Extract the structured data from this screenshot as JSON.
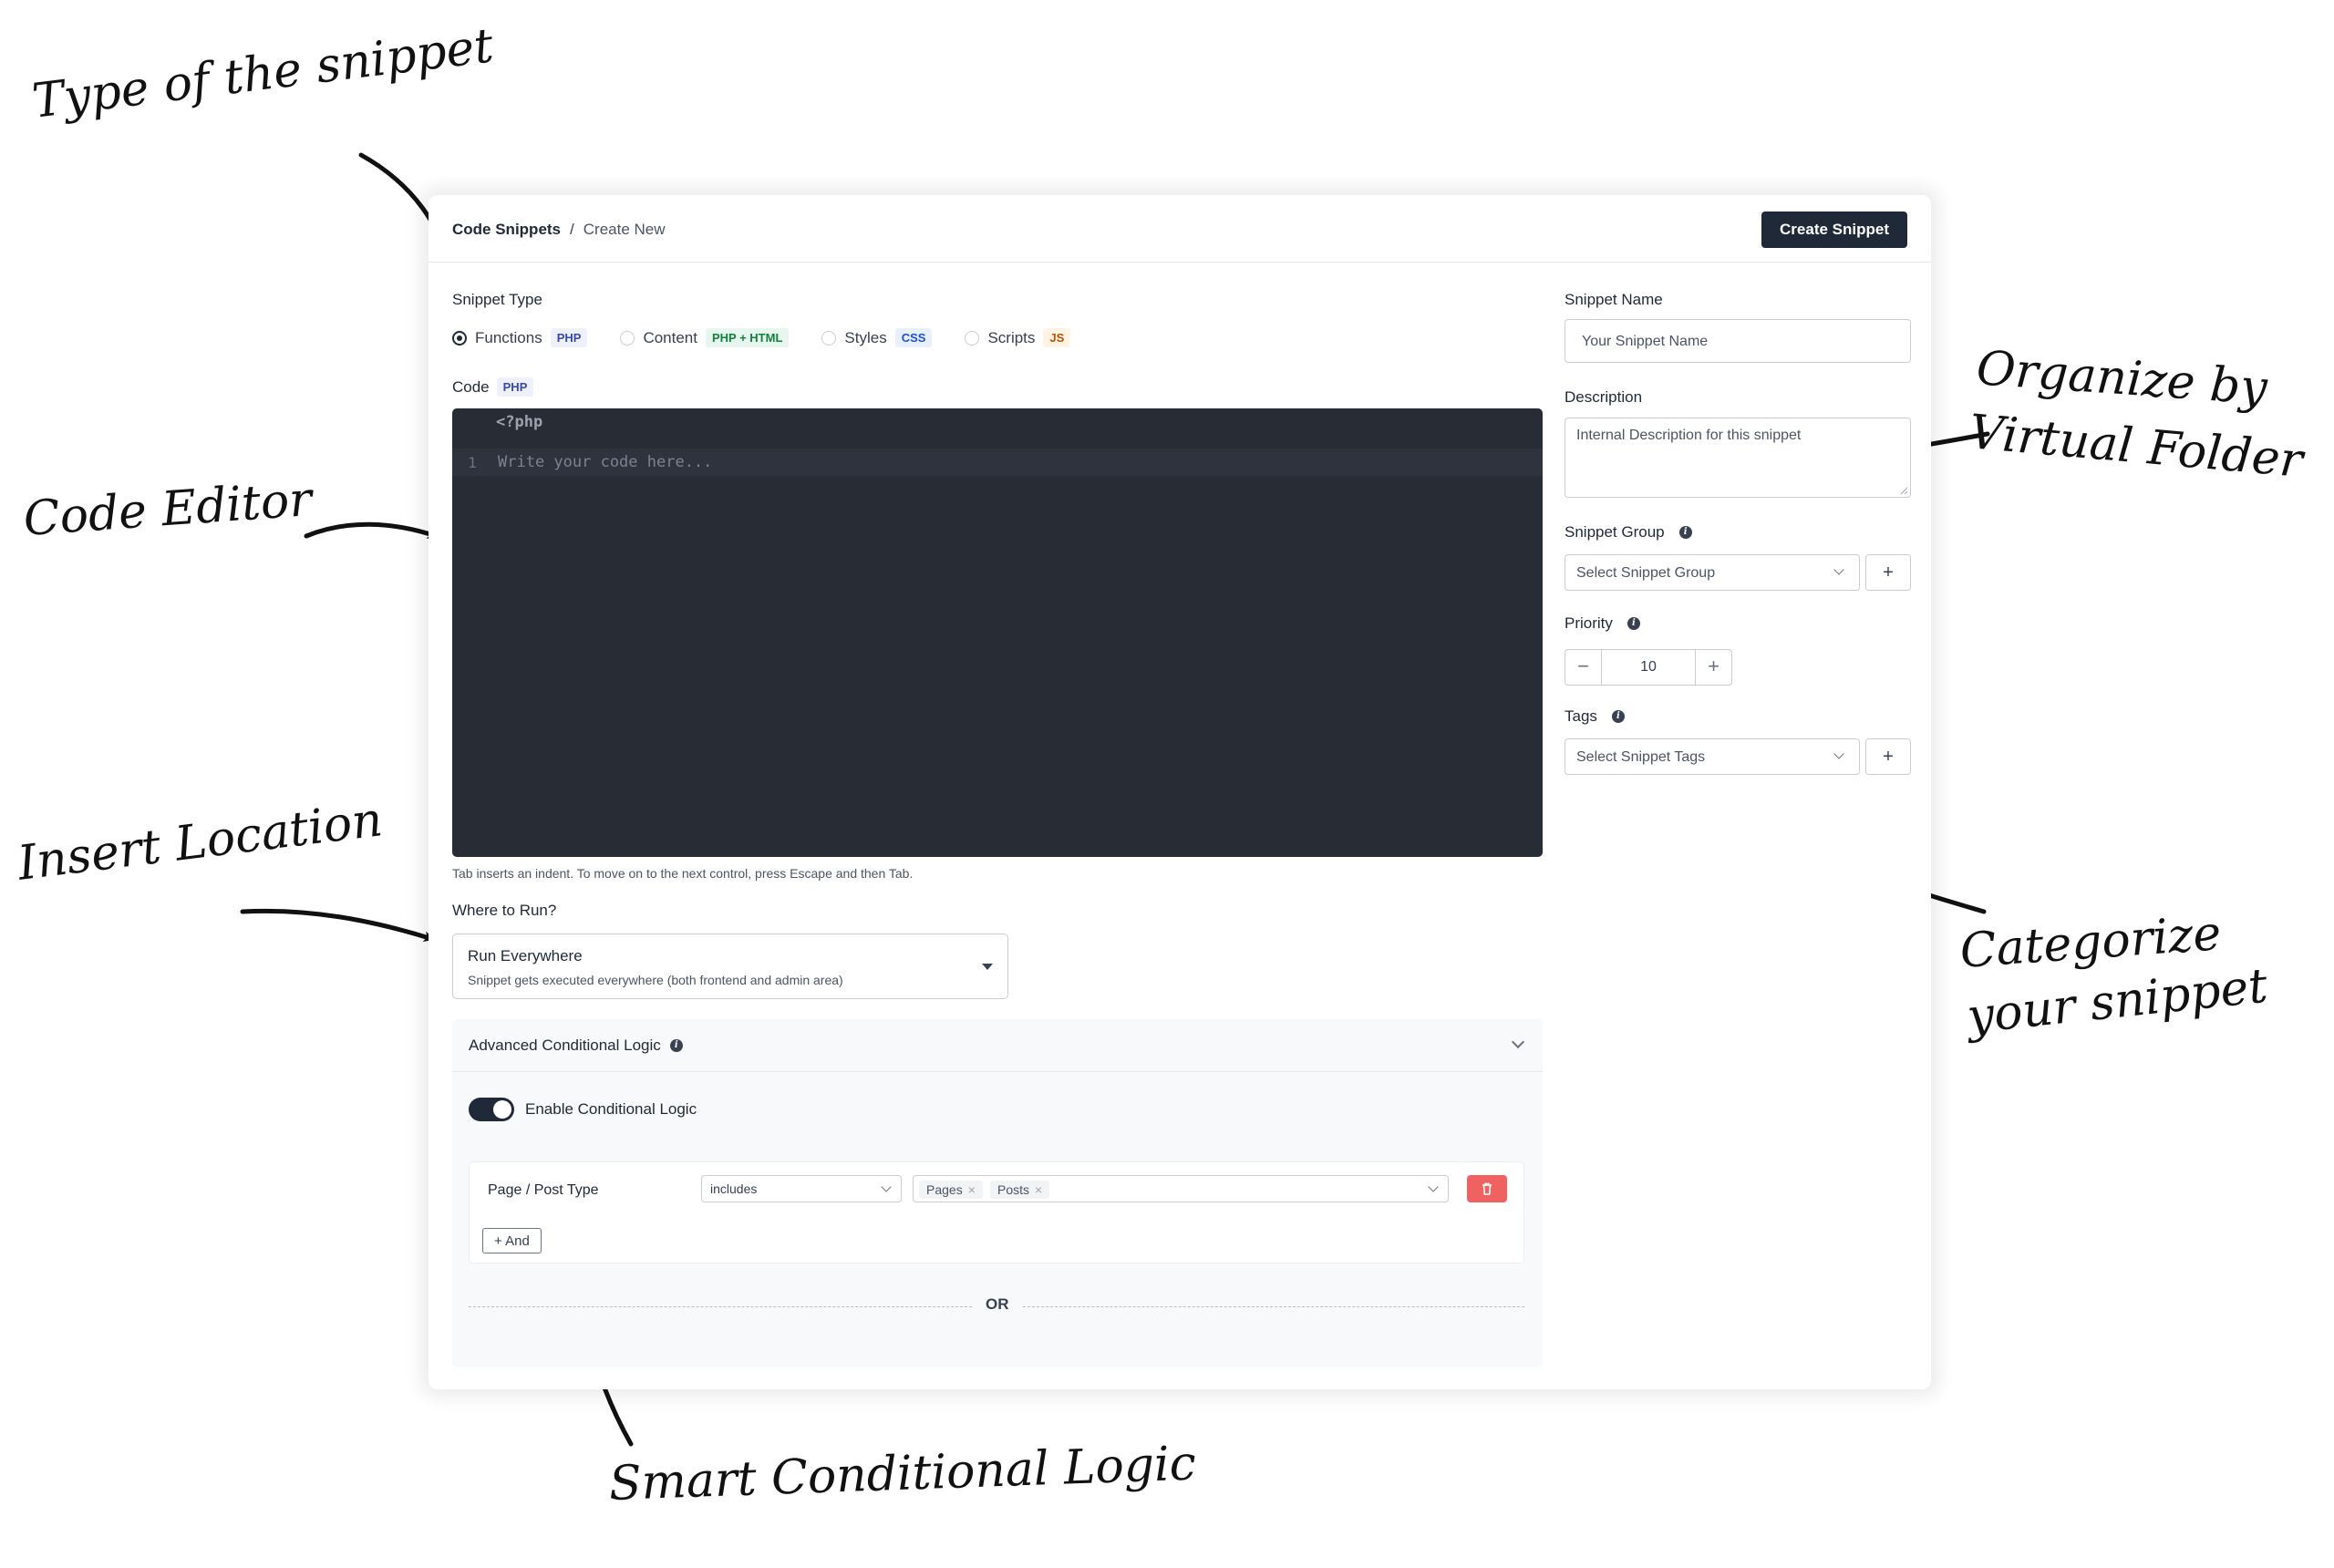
{
  "annotations": {
    "type": "Type of the snippet",
    "editor": "Code Editor",
    "location": "Insert Location",
    "folder_line1": "Organize by",
    "folder_line2": "Virtual Folder",
    "categorize_line1": "Categorize",
    "categorize_line2": "your snippet",
    "conditional": "Smart Conditional Logic"
  },
  "breadcrumb": {
    "root": "Code Snippets",
    "separator": "/",
    "current": "Create New"
  },
  "header": {
    "create_button": "Create Snippet"
  },
  "snippet_type": {
    "label": "Snippet Type",
    "options": [
      {
        "label": "Functions",
        "badge": "PHP",
        "selected": true
      },
      {
        "label": "Content",
        "badge": "PHP + HTML",
        "selected": false
      },
      {
        "label": "Styles",
        "badge": "CSS",
        "selected": false
      },
      {
        "label": "Scripts",
        "badge": "JS",
        "selected": false
      }
    ]
  },
  "code": {
    "label": "Code",
    "badge": "PHP",
    "header": "<?php",
    "line_number": "1",
    "placeholder": "Write your code here...",
    "hint": "Tab inserts an indent. To move on to the next control, press Escape and then Tab."
  },
  "where_to_run": {
    "label": "Where to Run?",
    "selected": "Run Everywhere",
    "description": "Snippet gets executed everywhere (both frontend and admin area)"
  },
  "advanced": {
    "title": "Advanced Conditional Logic",
    "toggle_label": "Enable Conditional Logic",
    "toggle_on": true,
    "condition": {
      "field": "Page / Post Type",
      "operator": "includes",
      "values": [
        "Pages",
        "Posts"
      ]
    },
    "and_button": "+ And",
    "or_label": "OR"
  },
  "right": {
    "name_label": "Snippet Name",
    "name_placeholder": "Your Snippet Name",
    "desc_label": "Description",
    "desc_placeholder": "Internal Description for this snippet",
    "group_label": "Snippet Group",
    "group_placeholder": "Select Snippet Group",
    "priority_label": "Priority",
    "priority_value": "10",
    "tags_label": "Tags",
    "tags_placeholder": "Select Snippet Tags",
    "plus": "+"
  },
  "colors": {
    "dark": "#1f2937",
    "editor_bg": "#282c34",
    "danger": "#f06262"
  }
}
